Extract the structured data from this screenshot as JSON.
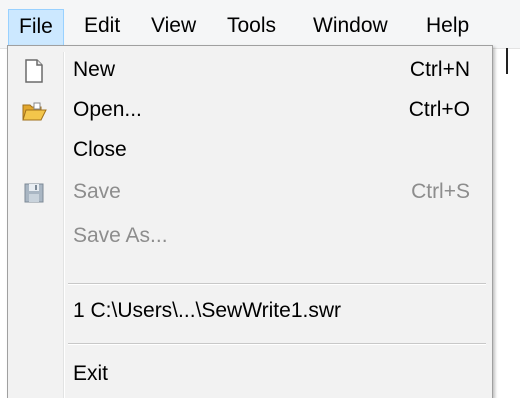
{
  "menubar": {
    "items": [
      {
        "label": "File"
      },
      {
        "label": "Edit"
      },
      {
        "label": "View"
      },
      {
        "label": "Tools"
      },
      {
        "label": "Window"
      },
      {
        "label": "Help"
      }
    ]
  },
  "file_menu": {
    "items": [
      {
        "label": "New",
        "shortcut": "Ctrl+N",
        "icon": "new-document-icon",
        "enabled": true
      },
      {
        "label": "Open...",
        "shortcut": "Ctrl+O",
        "icon": "open-folder-icon",
        "enabled": true
      },
      {
        "label": "Close",
        "shortcut": "",
        "icon": "",
        "enabled": true
      },
      {
        "label": "Save",
        "shortcut": "Ctrl+S",
        "icon": "save-disk-icon",
        "enabled": false
      },
      {
        "label": "Save As...",
        "shortcut": "",
        "icon": "",
        "enabled": false
      },
      {
        "label": "1 C:\\Users\\...\\SewWrite1.swr",
        "shortcut": "",
        "icon": "",
        "enabled": true
      },
      {
        "label": "Exit",
        "shortcut": "",
        "icon": "",
        "enabled": true
      }
    ]
  },
  "colors": {
    "active_menu_bg": "#cce8ff",
    "active_menu_border": "#99d1ff",
    "disabled_text": "#8d8d8d",
    "folder_yellow": "#f3c64b"
  }
}
